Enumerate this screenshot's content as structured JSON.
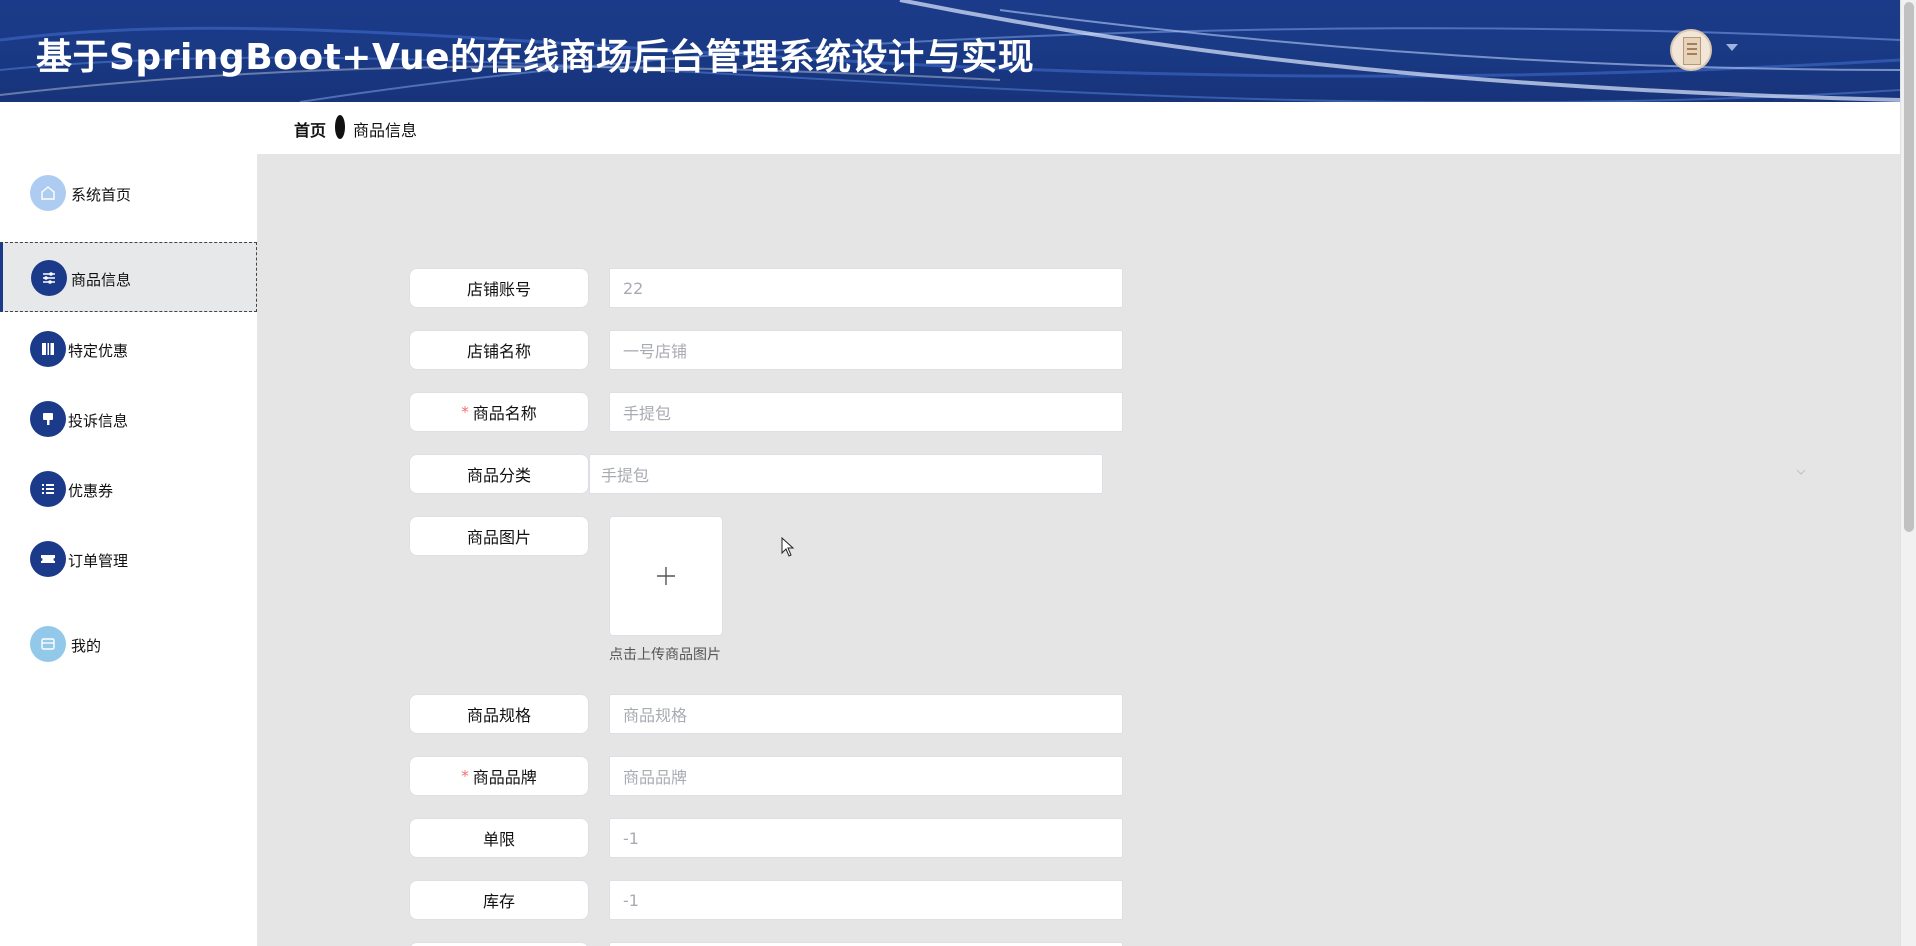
{
  "header": {
    "title": "基于SpringBoot+Vue的在线商场后台管理系统设计与实现",
    "avatar_icon": "avatar-image",
    "dropdown_icon": "caret-down-icon"
  },
  "breadcrumb": {
    "home": "首页",
    "current": "商品信息"
  },
  "sidebar": {
    "items": [
      {
        "label": "系统首页",
        "icon": "home-icon",
        "active": false
      },
      {
        "label": "商品信息",
        "icon": "sliders-icon",
        "active": true
      },
      {
        "label": "特定优惠",
        "icon": "book-icon",
        "active": false
      },
      {
        "label": "投诉信息",
        "icon": "brush-icon",
        "active": false
      },
      {
        "label": "优惠券",
        "icon": "list-icon",
        "active": false
      },
      {
        "label": "订单管理",
        "icon": "ticket-icon",
        "active": false
      },
      {
        "label": "我的",
        "icon": "card-icon",
        "active": false
      }
    ]
  },
  "form": {
    "shop_account": {
      "label": "店铺账号",
      "value": "22"
    },
    "shop_name": {
      "label": "店铺名称",
      "value": "一号店铺"
    },
    "product_name": {
      "label": "商品名称",
      "value": "手提包",
      "required_mark": "*"
    },
    "product_category": {
      "label": "商品分类",
      "value": "手提包"
    },
    "product_image": {
      "label": "商品图片",
      "upload_tip": "点击上传商品图片"
    },
    "product_spec": {
      "label": "商品规格",
      "placeholder": "商品规格"
    },
    "product_brand": {
      "label": "商品品牌",
      "placeholder": "商品品牌",
      "required_mark": "*"
    },
    "limit": {
      "label": "单限",
      "value": "-1"
    },
    "stock": {
      "label": "库存",
      "value": "-1"
    }
  },
  "colors": {
    "header_bg": "#1b3b8a",
    "content_bg": "#e5e5e5",
    "required": "#f56c6c"
  }
}
